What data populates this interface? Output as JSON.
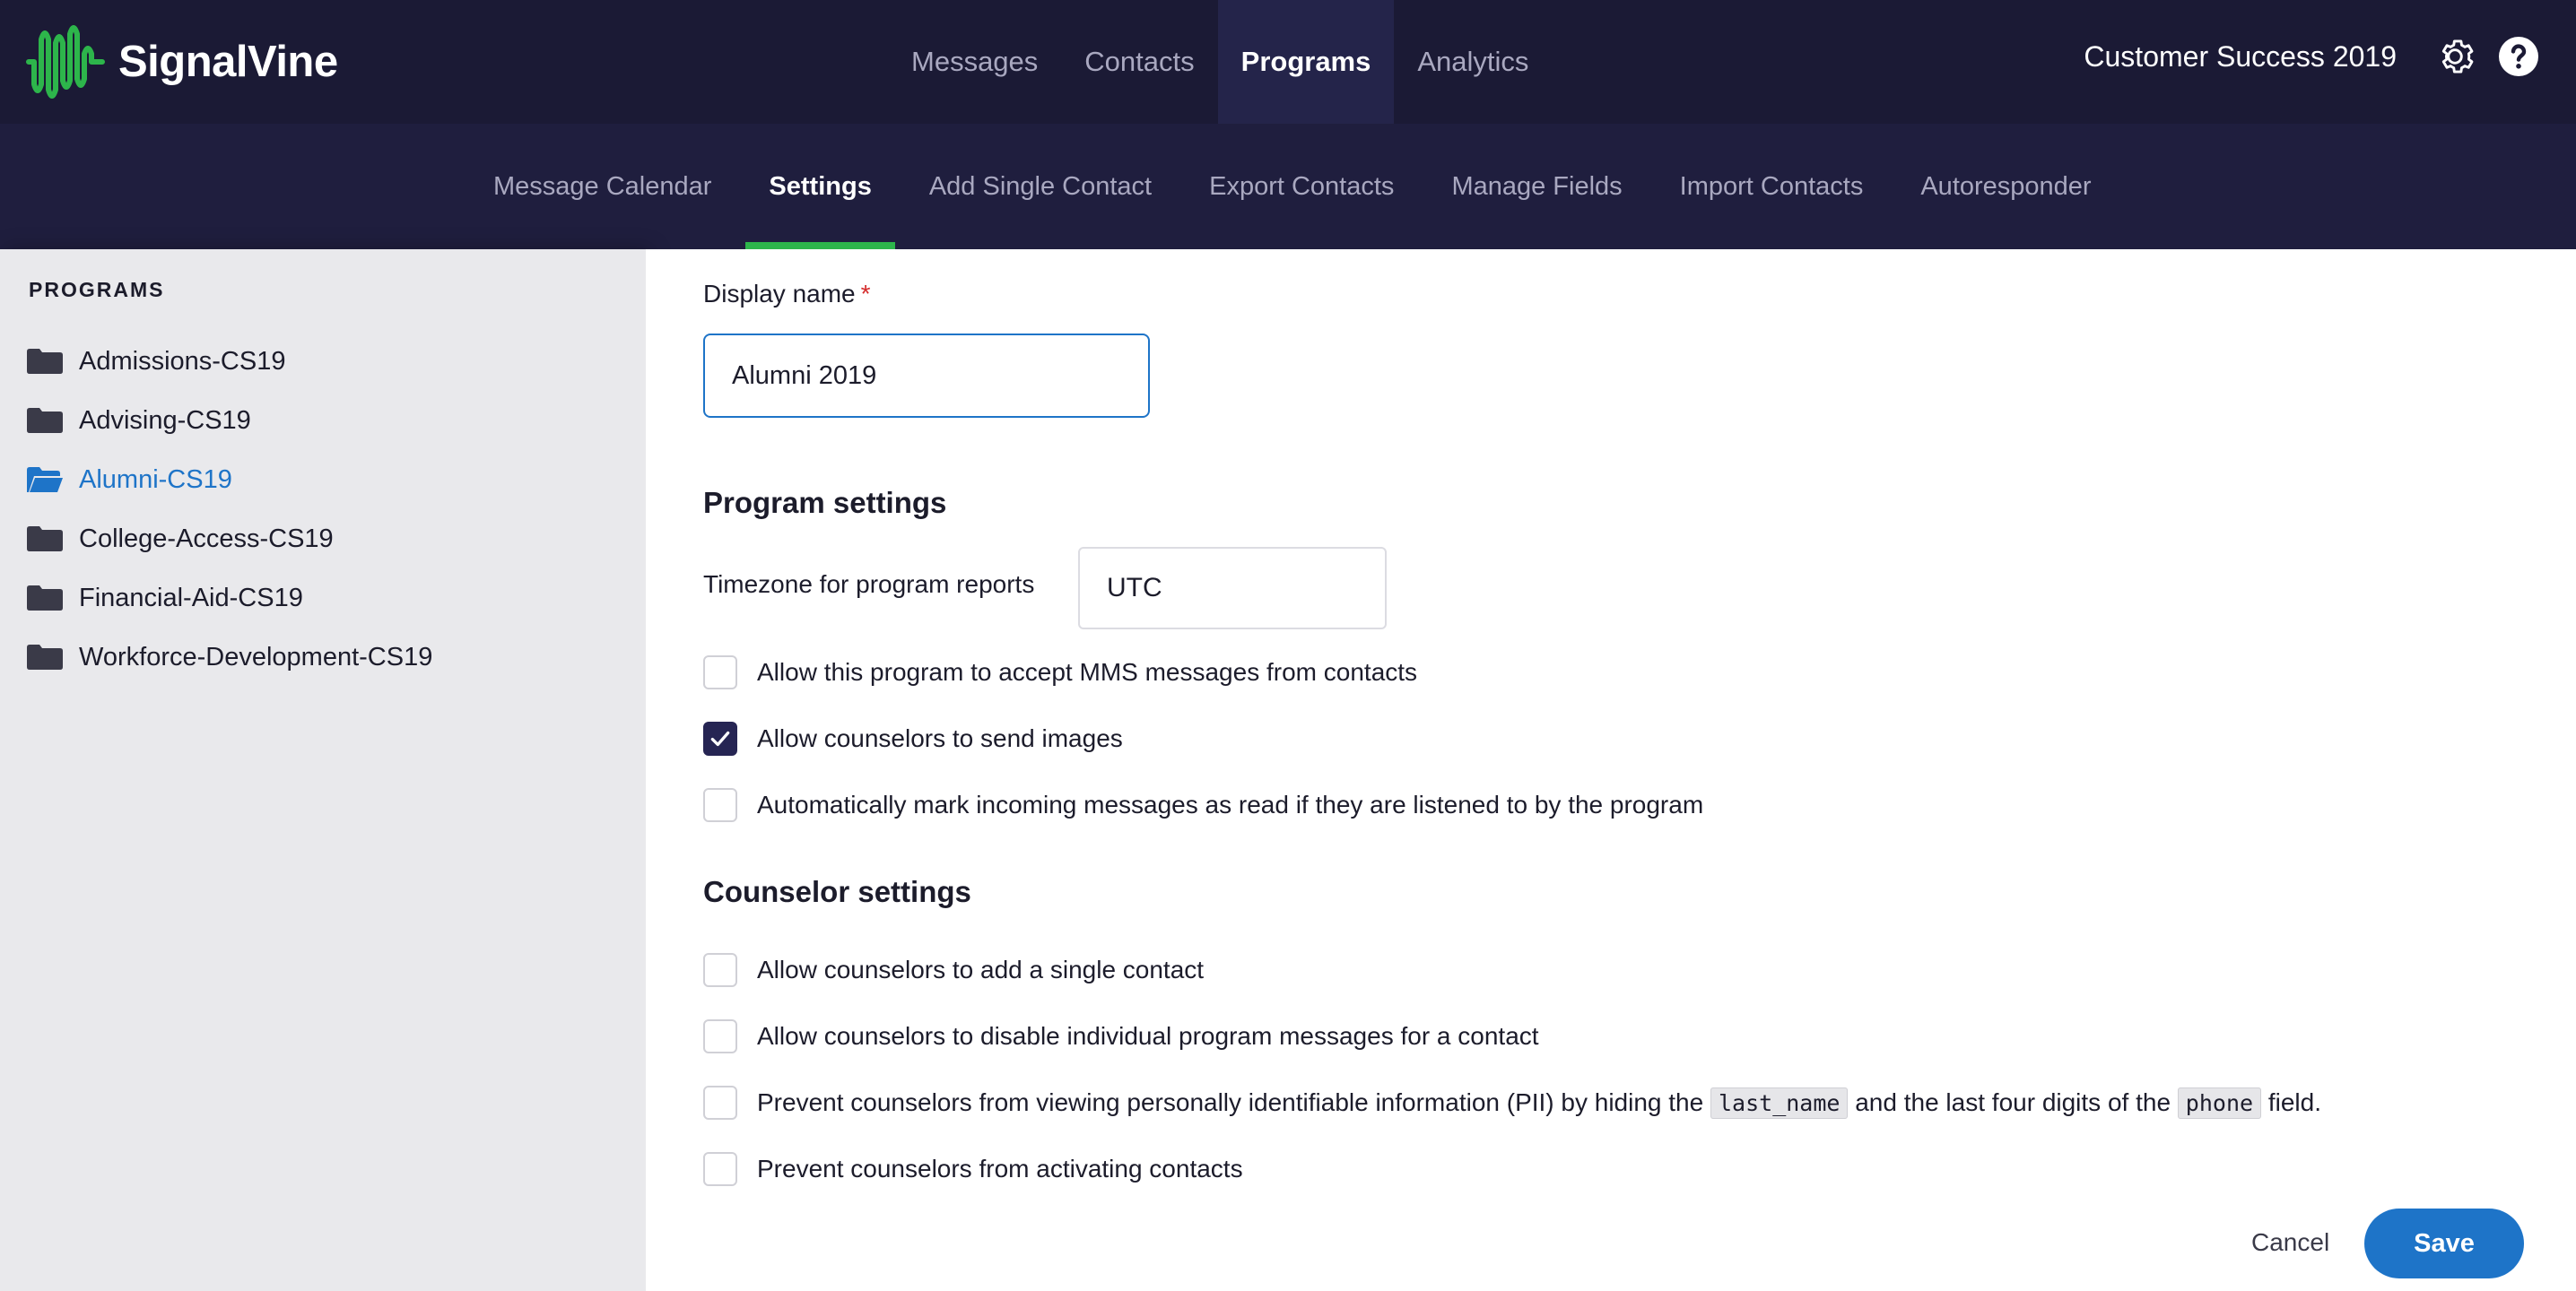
{
  "brand": {
    "name": "SignalVine",
    "accent": "#2db54b"
  },
  "topnav": {
    "items": [
      {
        "label": "Messages"
      },
      {
        "label": "Contacts"
      },
      {
        "label": "Programs"
      },
      {
        "label": "Analytics"
      }
    ],
    "active": "Programs",
    "org_name": "Customer Success 2019",
    "settings_icon": "gear-icon",
    "help_icon": "help-icon"
  },
  "subnav": {
    "items": [
      {
        "label": "Message Calendar"
      },
      {
        "label": "Settings"
      },
      {
        "label": "Add Single Contact"
      },
      {
        "label": "Export Contacts"
      },
      {
        "label": "Manage Fields"
      },
      {
        "label": "Import Contacts"
      },
      {
        "label": "Autoresponder"
      }
    ],
    "active": "Settings"
  },
  "sidebar": {
    "heading": "PROGRAMS",
    "items": [
      {
        "label": "Admissions-CS19"
      },
      {
        "label": "Advising-CS19"
      },
      {
        "label": "Alumni-CS19"
      },
      {
        "label": "College-Access-CS19"
      },
      {
        "label": "Financial-Aid-CS19"
      },
      {
        "label": "Workforce-Development-CS19"
      }
    ],
    "active": "Alumni-CS19"
  },
  "form": {
    "display_name_label": "Display name",
    "required_mark": "*",
    "display_name_value": "Alumni 2019",
    "program_settings_title": "Program settings",
    "timezone_label": "Timezone for program reports",
    "timezone_value": "UTC",
    "program_checks": [
      {
        "label": "Allow this program to accept MMS messages from contacts",
        "checked": false
      },
      {
        "label": "Allow counselors to send images",
        "checked": true
      },
      {
        "label": "Automatically mark incoming messages as read if they are listened to by the program",
        "checked": false
      }
    ],
    "counselor_settings_title": "Counselor settings",
    "counselor_checks": [
      {
        "label": "Allow counselors to add a single contact",
        "checked": false
      },
      {
        "label": "Allow counselors to disable individual program messages for a contact",
        "checked": false
      },
      {
        "label_part1": "Prevent counselors from viewing personally identifiable information (PII) by hiding the",
        "code1": "last_name",
        "label_part2": "and the last four digits of the",
        "code2": "phone",
        "label_part3": "field.",
        "checked": false
      },
      {
        "label": "Prevent counselors from activating contacts",
        "checked": false
      }
    ],
    "cancel_label": "Cancel",
    "save_label": "Save"
  },
  "colors": {
    "topbar": "#1b1a35",
    "subbar": "#1f1e3e",
    "primary": "#1e74c8",
    "checkbox_checked": "#262553"
  }
}
